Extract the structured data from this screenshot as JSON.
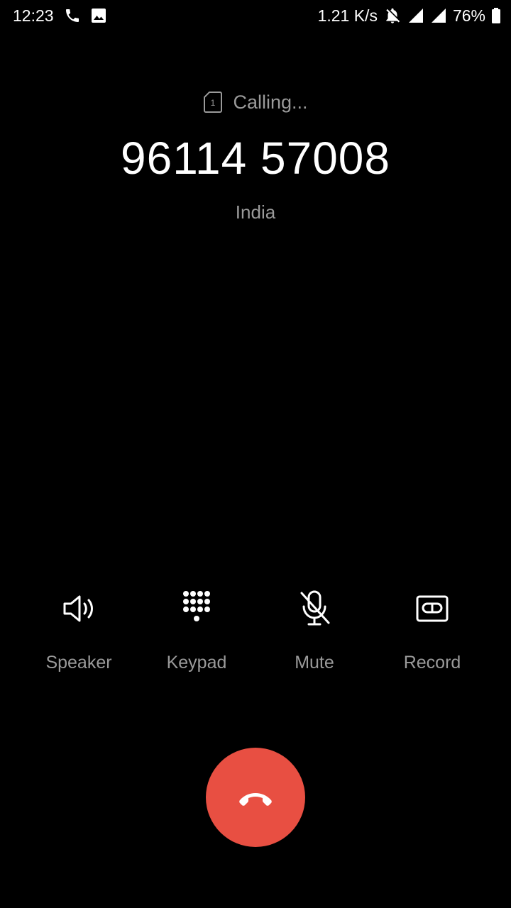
{
  "status_bar": {
    "time": "12:23",
    "network_speed": "1.21 K/s",
    "battery": "76%",
    "icons": [
      "phone-icon",
      "image-icon",
      "bell-off-icon",
      "signal-icon",
      "signal-icon",
      "battery-icon"
    ]
  },
  "call": {
    "sim_slot": "1",
    "status": "Calling...",
    "number": "96114 57008",
    "location": "India"
  },
  "actions": [
    {
      "label": "Speaker",
      "icon": "speaker-icon"
    },
    {
      "label": "Keypad",
      "icon": "keypad-icon"
    },
    {
      "label": "Mute",
      "icon": "mic-off-icon"
    },
    {
      "label": "Record",
      "icon": "record-icon"
    }
  ],
  "end_call": {
    "icon": "end-call-icon",
    "color": "#e84f42"
  },
  "colors": {
    "background": "#000000",
    "primary_text": "#ffffff",
    "secondary_text": "#9a9a9a",
    "end_call": "#e84f42"
  }
}
